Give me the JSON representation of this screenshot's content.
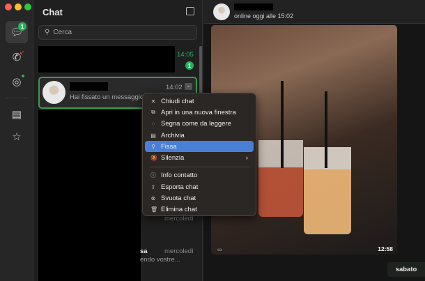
{
  "sidebar": {
    "chats_badge": "1",
    "items": [
      "chat-icon",
      "phone-icon",
      "status-icon",
      "archive-icon",
      "star-icon"
    ]
  },
  "list": {
    "title": "Chat",
    "search_placeholder": "Cerca",
    "chats": [
      {
        "time": "14:05",
        "unread": "1"
      },
      {
        "preview": "Hai fissato un messaggio.",
        "time": "14:02"
      },
      {
        "time": "mercoledì"
      },
      {
        "name_partial": "sa",
        "preview": "endo vostre...",
        "time": "mercoledì"
      }
    ]
  },
  "context_menu": {
    "items": [
      {
        "icon": "✕",
        "label": "Chiudi chat"
      },
      {
        "icon": "⧉",
        "label": "Apri in una nuova finestra"
      },
      {
        "icon": "◌",
        "label": "Segna come da leggere"
      },
      {
        "icon": "▤",
        "label": "Archivia"
      },
      {
        "icon": "⚲",
        "label": "Fissa",
        "selected": true
      },
      {
        "icon": "🔕",
        "label": "Silenzia",
        "submenu": true
      },
      {
        "icon": "ⓘ",
        "label": "Info contatto"
      },
      {
        "icon": "⇪",
        "label": "Esporta chat"
      },
      {
        "icon": "⊗",
        "label": "Svuota chat"
      },
      {
        "icon": "🗑",
        "label": "Elimina chat"
      }
    ]
  },
  "chat": {
    "status": "online oggi alle 15:02",
    "photo_time": "12:58",
    "date_chip": "sabato"
  },
  "colors": {
    "accent": "#25b35a",
    "selected": "#4a7fd8"
  }
}
